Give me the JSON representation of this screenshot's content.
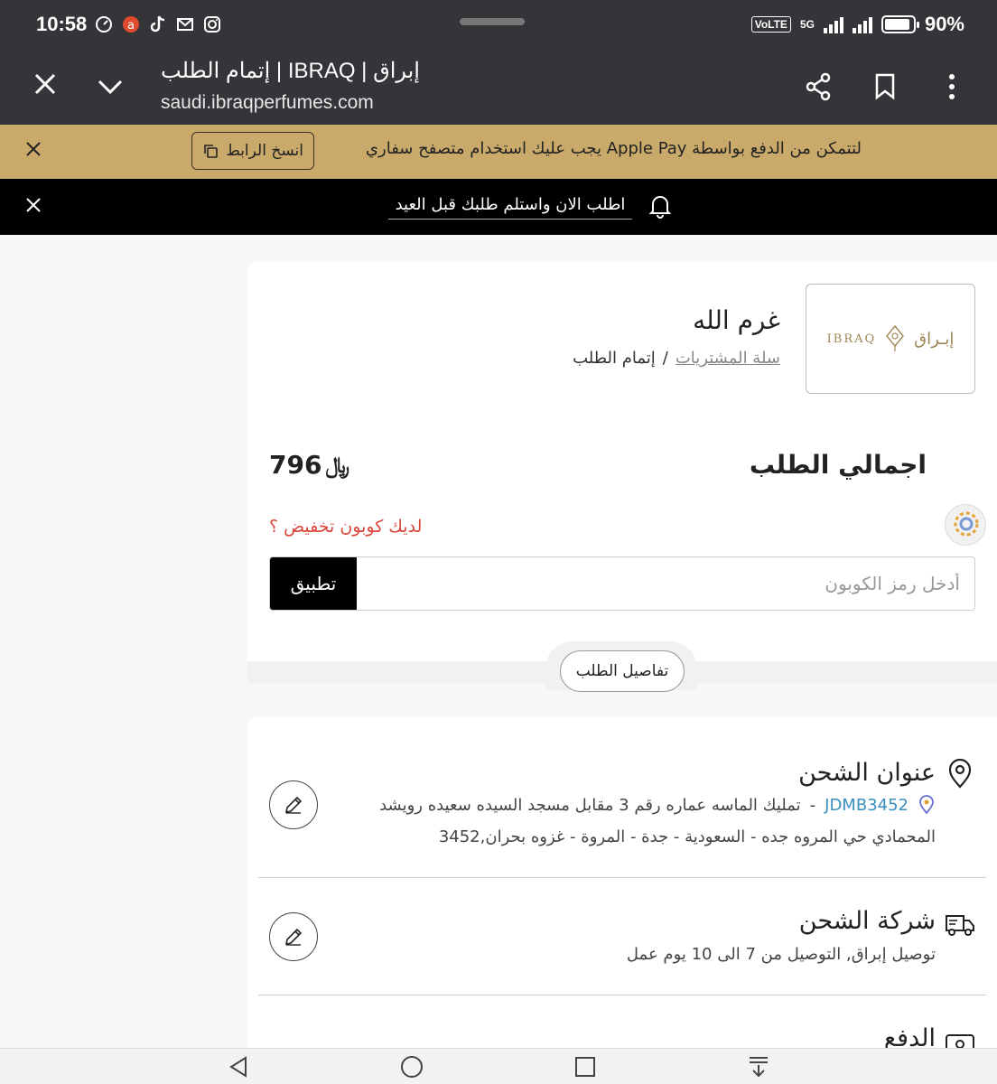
{
  "status_bar": {
    "time": "10:58",
    "battery": "90%",
    "battery_level": 0.9,
    "network": "VoLTE",
    "network_5g": "5G"
  },
  "browser": {
    "title": "إبراق | IBRAQ | إتمام الطلب",
    "url": "saudi.ibraqperfumes.com"
  },
  "apple_pay_banner": {
    "text": "لتتمكن من الدفع بواسطة Apple Pay يجب عليك استخدام متصفح سفاري",
    "copy_label": "انسخ الرابط",
    "background": "#c9aa6a"
  },
  "announcement": {
    "text": "اطلب الان واستلم طلبك قبل العيد"
  },
  "store": {
    "logo_en": "IBRAQ",
    "logo_ar": "إبـراق",
    "name": "غرم الله",
    "breadcrumb": {
      "cart": "سلة المشتريات",
      "separator": "/",
      "current": "إتمام الطلب"
    }
  },
  "order_total": {
    "label": "اجمالي الطلب",
    "amount": "796",
    "currency_symbol": "﷼"
  },
  "coupon": {
    "question": "لديك كوبون تخفيض ؟",
    "placeholder": "أدخل رمز الكوبون",
    "apply_label": "تطبيق",
    "question_color": "#d9473a"
  },
  "order_details_label": "تفاصيل الطلب",
  "shipping_address": {
    "title": "عنوان الشحن",
    "code": "JDMB3452",
    "separator": "-",
    "line1": "تمليك الماسه عماره رقم 3 مقابل مسجد السيده سعيده رويشد",
    "line2": "المحمادي حي المروه جده - السعودية - جدة - المروة - غزوه بحران,3452"
  },
  "shipping_company": {
    "title": "شركة الشحن",
    "description": "توصيل إبراق, التوصيل من 7 الى 10 يوم عمل"
  },
  "payment": {
    "title": "الدفع"
  }
}
